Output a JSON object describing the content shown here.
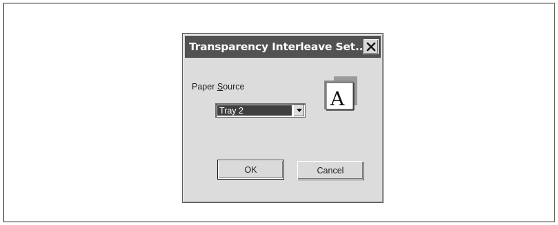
{
  "dialog": {
    "title": "Transparency Interleave Set...",
    "close_icon": "close-icon"
  },
  "paper_source": {
    "label_mnemonic": "S",
    "label_prefix": "Paper ",
    "label_suffix": "ource",
    "selected": "Tray 2",
    "dropdown_icon": "chevron-down-icon"
  },
  "preview": {
    "glyph": "A",
    "icon": "page-preview-icon"
  },
  "buttons": {
    "ok_label": "OK",
    "cancel_label": "Cancel"
  }
}
